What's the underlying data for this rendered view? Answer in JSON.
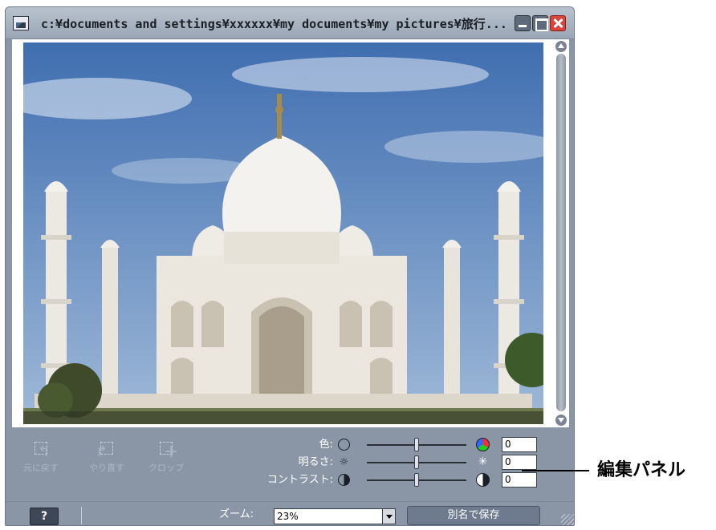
{
  "window": {
    "title": "c:¥documents and settings¥xxxxxx¥my documents¥my pictures¥旅行...",
    "icon": "image-viewer-icon"
  },
  "image": {
    "subject": "",
    "colors": {
      "sky": "#4a78b8",
      "marble": "#f1eee8",
      "ground": "#9a8b6c"
    }
  },
  "edit_panel": {
    "tools": [
      {
        "label": "元に戻す",
        "icon": "undo-icon"
      },
      {
        "label": "やり直す",
        "icon": "redo-icon"
      },
      {
        "label": "クロップ",
        "icon": "crop-icon"
      }
    ],
    "adjustments": [
      {
        "label": "色:",
        "value": "0",
        "slider_fraction": 0.5,
        "min_icon": "color-off-icon",
        "max_icon": "color-wheel-icon"
      },
      {
        "label": "明るさ:",
        "value": "0",
        "slider_fraction": 0.5,
        "min_icon": "sun-dim-icon",
        "max_icon": "sun-bright-icon"
      },
      {
        "label": "コントラスト:",
        "value": "0",
        "slider_fraction": 0.5,
        "min_icon": "contrast-low-icon",
        "max_icon": "contrast-high-icon"
      }
    ]
  },
  "bottom_bar": {
    "help_label": "?",
    "zoom_label": "ズーム:",
    "zoom_value": "23%",
    "saveas_label": "別名で保存"
  },
  "annotation": {
    "label": "編集パネル"
  },
  "theme": {
    "window_bg": "#8a96a6",
    "title_bg": "#b9c3cf",
    "accent_close": "#d9453a"
  }
}
